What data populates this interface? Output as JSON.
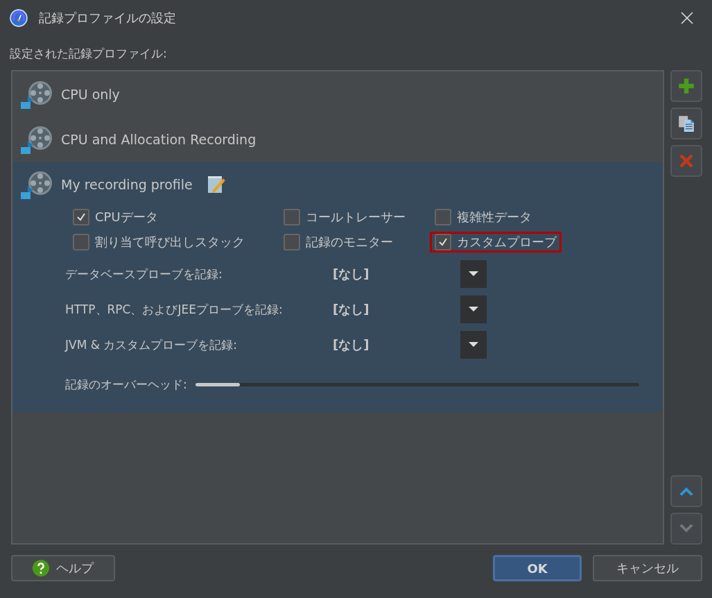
{
  "window": {
    "title": "記録プロファイルの設定"
  },
  "list_label": "設定された記録プロファイル:",
  "profiles": [
    {
      "name": "CPU only",
      "selected": false
    },
    {
      "name": "CPU and Allocation Recording",
      "selected": false
    },
    {
      "name": "My recording profile",
      "selected": true,
      "options": [
        {
          "label": "CPUデータ",
          "checked": true,
          "highlighted": false
        },
        {
          "label": "コールトレーサー",
          "checked": false,
          "highlighted": false
        },
        {
          "label": "複雑性データ",
          "checked": false,
          "highlighted": false
        },
        {
          "label": "割り当て呼び出しスタック",
          "checked": false,
          "highlighted": false
        },
        {
          "label": "記録のモニター",
          "checked": false,
          "highlighted": false
        },
        {
          "label": "カスタムプローブ",
          "checked": true,
          "highlighted": true
        }
      ],
      "dropdowns": [
        {
          "label": "データベースプローブを記録:",
          "value": "[なし]"
        },
        {
          "label": "HTTP、RPC、およびJEEプローブを記録:",
          "value": "[なし]"
        },
        {
          "label": "JVM & カスタムプローブを記録:",
          "value": "[なし]"
        }
      ],
      "overhead": {
        "label": "記録のオーバーヘッド:",
        "level": 0.1
      }
    }
  ],
  "side_buttons": {
    "move_up": {
      "disabled": false
    },
    "move_down": {
      "disabled": true
    }
  },
  "footer": {
    "help": "ヘルプ",
    "ok": "OK",
    "cancel": "キャンセル"
  }
}
